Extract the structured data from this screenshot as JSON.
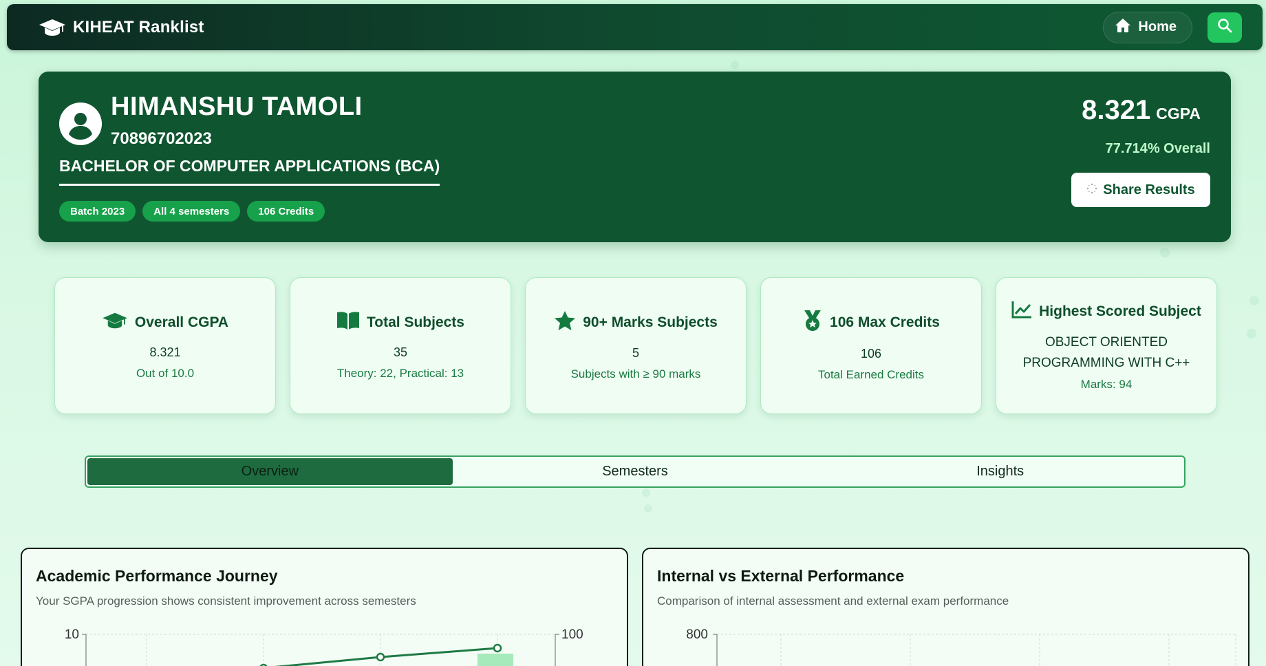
{
  "nav": {
    "brand": "KIHEAT Ranklist",
    "home_label": "Home"
  },
  "profile": {
    "name": "HIMANSHU TAMOLI",
    "roll": "70896702023",
    "course": "BACHELOR OF COMPUTER APPLICATIONS (BCA)",
    "pills": [
      "Batch 2023",
      "All 4 semesters",
      "106 Credits"
    ],
    "cgpa_value": "8.321",
    "cgpa_unit": "CGPA",
    "overall": "77.714% Overall",
    "share_label": "Share Results"
  },
  "stats": [
    {
      "icon": "graduation-cap-icon",
      "title": "Overall CGPA",
      "value": "8.321",
      "sub": "Out of 10.0"
    },
    {
      "icon": "book-icon",
      "title": "Total Subjects",
      "value": "35",
      "sub": "Theory: 22, Practical: 13"
    },
    {
      "icon": "star-icon",
      "title": "90+ Marks Subjects",
      "value": "5",
      "sub": "Subjects with ≥ 90 marks"
    },
    {
      "icon": "medal-icon",
      "title": "106 Max Credits",
      "value": "106",
      "sub": "Total Earned Credits"
    },
    {
      "icon": "chart-line-icon",
      "title": "Highest Scored Subject",
      "value": "OBJECT ORIENTED PROGRAMMING WITH C++",
      "sub": "Marks: 94"
    }
  ],
  "tabs": [
    "Overview",
    "Semesters",
    "Insights"
  ],
  "active_tab": "Overview",
  "panels": {
    "journey": {
      "title": "Academic Performance Journey",
      "subtitle": "Your SGPA progression shows consistent improvement across semesters",
      "left_axis_top": "10",
      "right_axis_top": "100"
    },
    "internal_external": {
      "title": "Internal vs External Performance",
      "subtitle": "Comparison of internal assessment and external exam performance",
      "axis_top": "800"
    }
  },
  "colors": {
    "nav_dark": "#0d2a22",
    "primary": "#0f5630",
    "accent": "#22c55e",
    "pill": "#16a14a"
  }
}
